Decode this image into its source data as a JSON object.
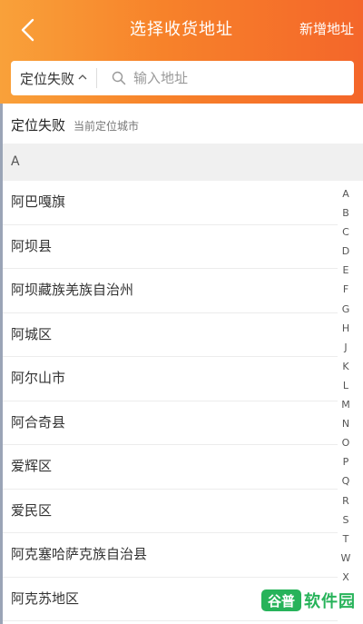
{
  "header": {
    "title": "选择收货地址",
    "add_label": "新增地址"
  },
  "search": {
    "location_label": "定位失败",
    "placeholder": "输入地址"
  },
  "current_location": {
    "value": "定位失败",
    "hint": "当前定位城市"
  },
  "section": {
    "letter": "A"
  },
  "cities": [
    "阿巴嘎旗",
    "阿坝县",
    "阿坝藏族羌族自治州",
    "阿城区",
    "阿尔山市",
    "阿合奇县",
    "爱辉区",
    "爱民区",
    "阿克塞哈萨克族自治县",
    "阿克苏地区"
  ],
  "alphabet": [
    "A",
    "B",
    "C",
    "D",
    "E",
    "F",
    "G",
    "H",
    "J",
    "K",
    "L",
    "M",
    "N",
    "O",
    "P",
    "Q",
    "R",
    "S",
    "T",
    "W",
    "X"
  ],
  "watermark": {
    "logo_text": "谷普",
    "brand_text": "软件园"
  },
  "colors": {
    "header_start": "#f9a13a",
    "header_end": "#f4662a",
    "watermark_green": "#27b35a"
  }
}
